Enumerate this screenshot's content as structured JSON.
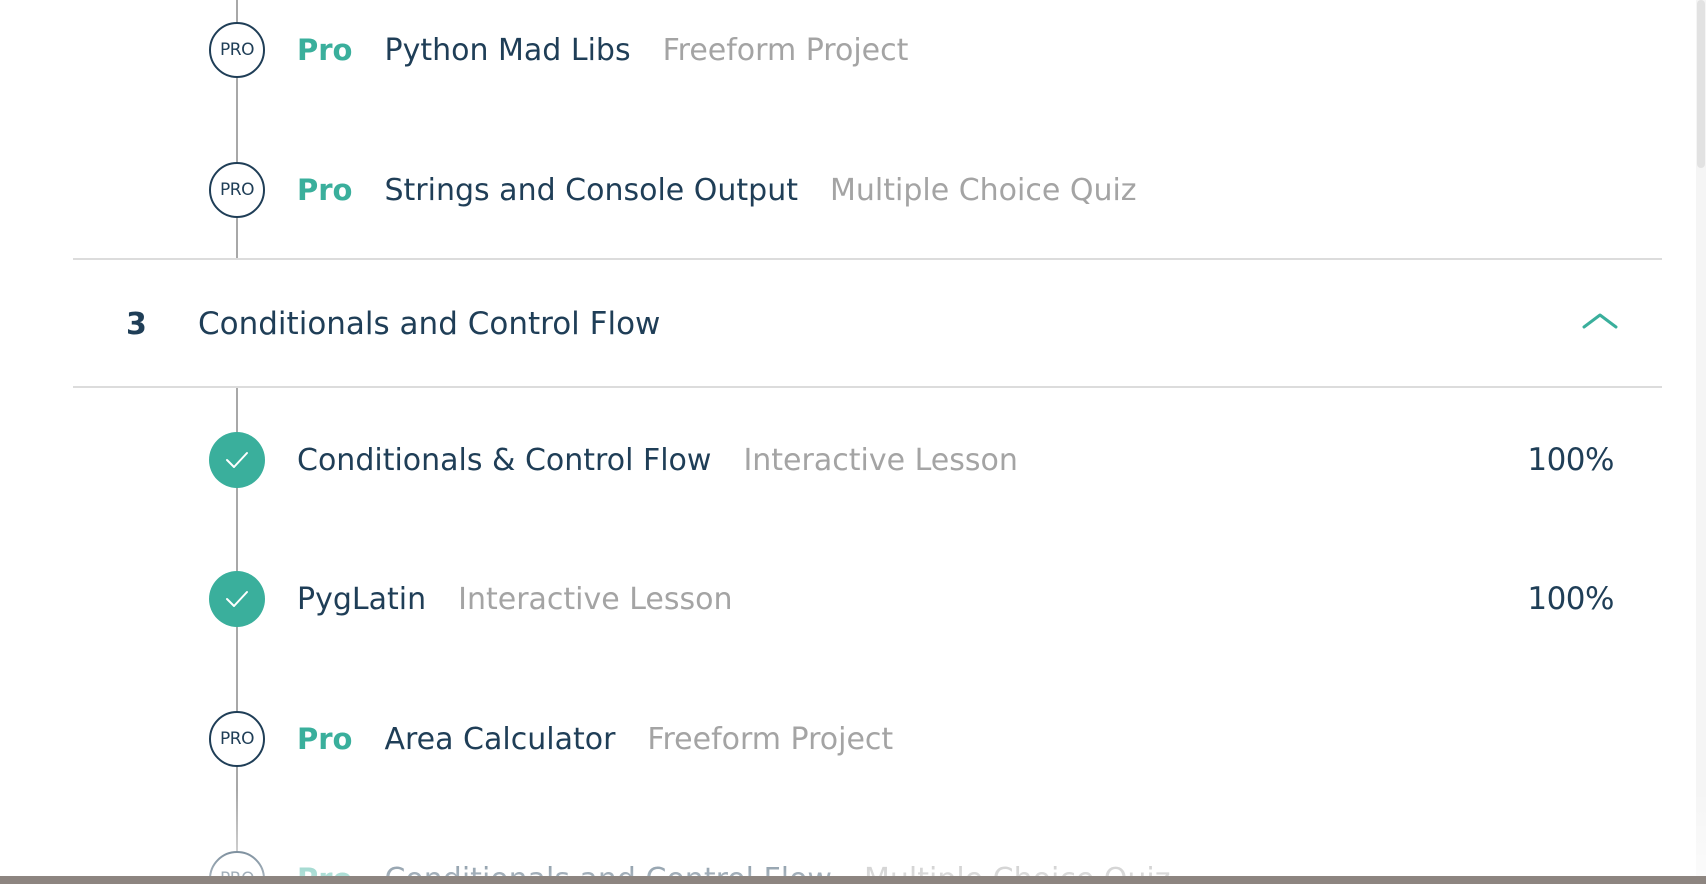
{
  "sections": [
    {
      "items": [
        {
          "pro_badge": "PRO",
          "pro_label": "Pro",
          "title": "Python Mad Libs",
          "type": "Freeform Project"
        },
        {
          "pro_badge": "PRO",
          "pro_label": "Pro",
          "title": "Strings and Console Output",
          "type": "Multiple Choice Quiz"
        }
      ]
    },
    {
      "number": "3",
      "title": "Conditionals and Control Flow",
      "expanded": true,
      "items": [
        {
          "title": "Conditionals & Control Flow",
          "type": "Interactive Lesson",
          "percent": "100%",
          "completed": true
        },
        {
          "title": "PygLatin",
          "type": "Interactive Lesson",
          "percent": "100%",
          "completed": true
        },
        {
          "pro_badge": "PRO",
          "pro_label": "Pro",
          "title": "Area Calculator",
          "type": "Freeform Project"
        },
        {
          "pro_badge": "PRO",
          "pro_label": "Pro",
          "title": "Conditionals and Control Flow",
          "type": "Multiple Choice Quiz"
        }
      ]
    }
  ],
  "colors": {
    "accent": "#3aaf9c",
    "text": "#1f3e57",
    "muted": "#a4a4a4",
    "divider": "#dcdcdc"
  },
  "icons": {
    "check": "check-icon",
    "chevron": "chevron-up-icon"
  }
}
